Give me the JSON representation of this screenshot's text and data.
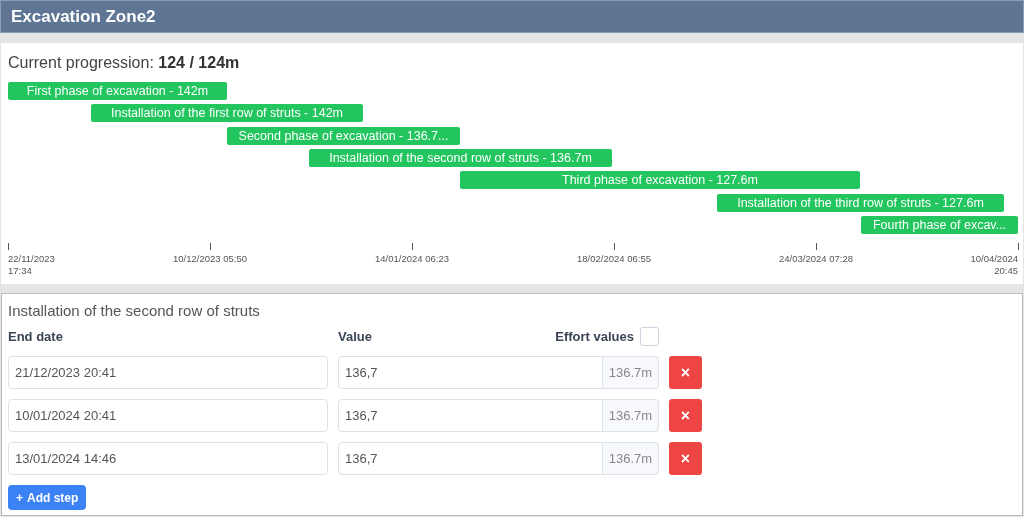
{
  "window": {
    "title": "Excavation Zone2"
  },
  "progress": {
    "label": "Current progression:",
    "value": "124 / 124m"
  },
  "timeline": {
    "bars": [
      {
        "label": "First phase of excavation - 142m"
      },
      {
        "label": "Installation of the first row of struts - 142m"
      },
      {
        "label": "Second phase of excavation - 136.7..."
      },
      {
        "label": "Installation of the second row of struts - 136.7m"
      },
      {
        "label": "Third phase of excavation - 127.6m"
      },
      {
        "label": "Installation of the third row of struts - 127.6m"
      },
      {
        "label": "Fourth phase of excav..."
      }
    ],
    "ticks": [
      {
        "date": "22/11/2023",
        "time": "17:34"
      },
      {
        "date": "10/12/2023 05:50"
      },
      {
        "date": "14/01/2024 06:23"
      },
      {
        "date": "18/02/2024 06:55"
      },
      {
        "date": "24/03/2024 07:28"
      },
      {
        "date": "10/04/2024",
        "time": "20:45"
      }
    ]
  },
  "detail": {
    "title": "Installation of the second row of struts",
    "columns": {
      "end_date": "End date",
      "value": "Value",
      "effort": "Effort values"
    },
    "effort_checked": false,
    "steps": [
      {
        "end_date": "21/12/2023 20:41",
        "value": "136,7",
        "unit_value": "136.7m",
        "delete": "×"
      },
      {
        "end_date": "10/01/2024 20:41",
        "value": "136,7",
        "unit_value": "136.7m",
        "delete": "×"
      },
      {
        "end_date": "13/01/2024 14:46",
        "value": "136,7",
        "unit_value": "136.7m",
        "delete": "×"
      }
    ],
    "add_button": {
      "icon": "+",
      "label": "Add step"
    }
  }
}
